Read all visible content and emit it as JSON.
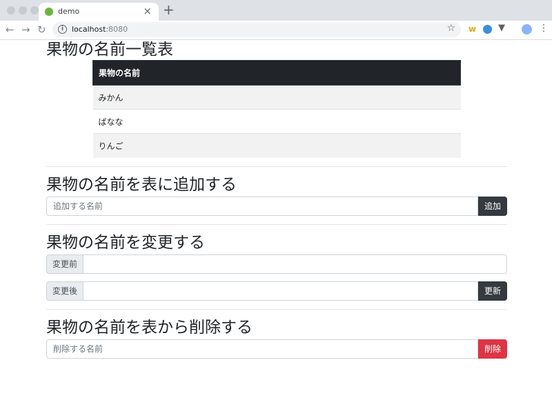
{
  "browser": {
    "tab_title": "demo",
    "url_host": "localhost",
    "url_port": ":8080",
    "extensions": [
      "w"
    ]
  },
  "list_section": {
    "title": "果物の名前一覧表",
    "column_header": "果物の名前",
    "rows": [
      "みかん",
      "ばなな",
      "りんご"
    ]
  },
  "add_section": {
    "title": "果物の名前を表に追加する",
    "placeholder": "追加する名前",
    "button": "追加"
  },
  "update_section": {
    "title": "果物の名前を変更する",
    "before_label": "変更前",
    "after_label": "変更後",
    "button": "更新"
  },
  "delete_section": {
    "title": "果物の名前を表から削除する",
    "placeholder": "削除する名前",
    "button": "削除"
  },
  "colors": {
    "dark": "#343a40",
    "danger": "#dc3545"
  }
}
